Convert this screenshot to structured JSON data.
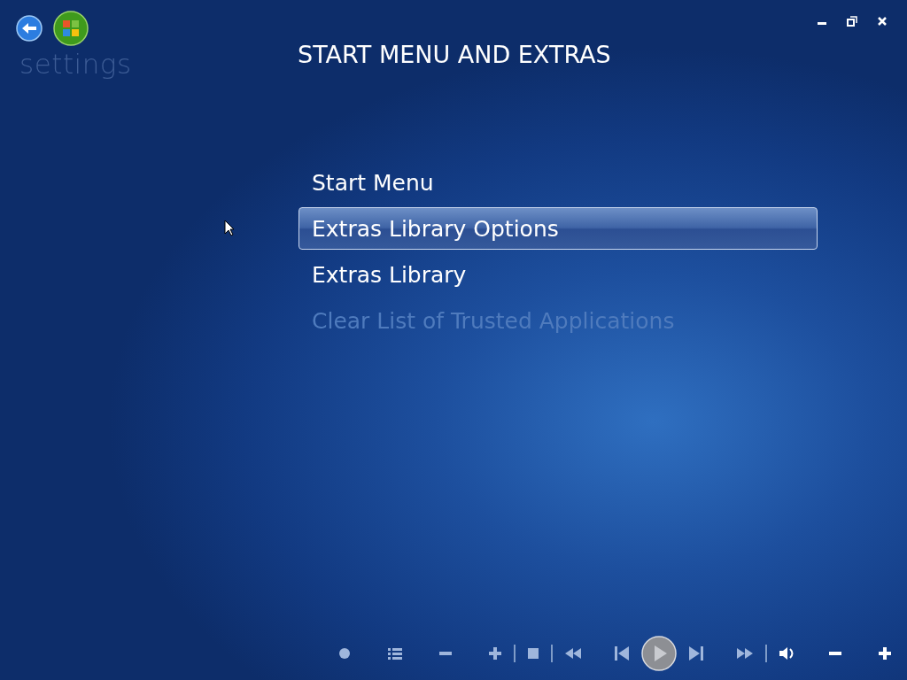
{
  "header": {
    "section": "settings",
    "title": "START MENU AND EXTRAS"
  },
  "menu": {
    "items": [
      {
        "label": "Start Menu",
        "selected": false,
        "disabled": false
      },
      {
        "label": "Extras Library Options",
        "selected": true,
        "disabled": false
      },
      {
        "label": "Extras Library",
        "selected": false,
        "disabled": false
      },
      {
        "label": "Clear List of Trusted Applications",
        "selected": false,
        "disabled": true
      }
    ]
  }
}
